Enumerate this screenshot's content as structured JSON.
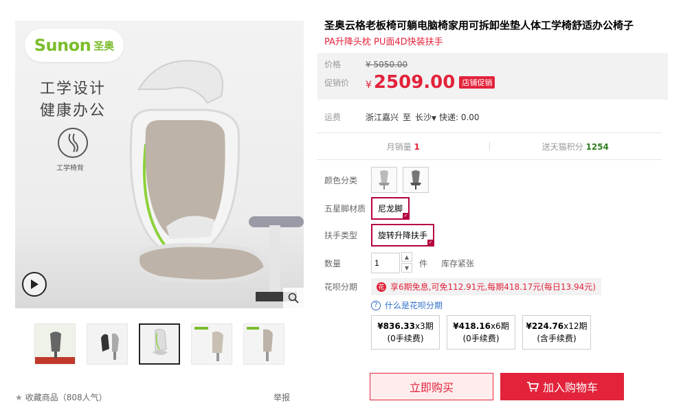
{
  "gallery": {
    "logo_text": "Sunon",
    "logo_cn": "圣奥",
    "slogan_line1": "工学设计",
    "slogan_line2": "健康办公",
    "feature_label": "工学椅背"
  },
  "favorite": {
    "label": "收藏商品",
    "count": "（808人气）",
    "report": "举报"
  },
  "product": {
    "title": "圣奥云格老板椅可躺电脑椅家用可拆卸坐垫人体工学椅舒适办公椅子",
    "subtitle": "PA升降头枕 PU面4D快装扶手"
  },
  "price": {
    "original_label": "价格",
    "original_value": "¥ 5050.00",
    "promo_label": "促销价",
    "promo_currency": "¥",
    "promo_value": "2509.00",
    "promo_tag": "店铺促销"
  },
  "shipping": {
    "label": "运费",
    "from": "浙江嘉兴",
    "to_label": "至",
    "to": "长沙",
    "method": "快递: 0.00"
  },
  "stats": {
    "sales_label": "月销量",
    "sales_value": "1",
    "points_label": "送天猫积分",
    "points_value": "1254"
  },
  "options": {
    "color_label": "颜色分类",
    "base_label": "五星脚材质",
    "base_value": "尼龙脚",
    "armrest_label": "扶手类型",
    "armrest_value": "旋转升降扶手",
    "qty_label": "数量",
    "qty_value": "1",
    "qty_unit": "件",
    "stock_text": "库存紧张"
  },
  "huabei": {
    "label": "花呗分期",
    "info": "享6期免息,可免112.91元,每期418.17元(每日13.94元)",
    "what_is": "什么是花呗分期",
    "plans": [
      {
        "amount": "¥836.33",
        "periods": "x3期",
        "fee": "(0手续费)"
      },
      {
        "amount": "¥418.16",
        "periods": "x6期",
        "fee": "(0手续费)"
      },
      {
        "amount": "¥224.76",
        "periods": "x12期",
        "fee": "(含手续费)"
      }
    ]
  },
  "actions": {
    "buy_now": "立即购买",
    "add_cart": "加入购物车"
  },
  "colors": {
    "accent": "#e2233b",
    "brand_green": "#7cbd2c",
    "link_blue": "#2d6ec8"
  }
}
